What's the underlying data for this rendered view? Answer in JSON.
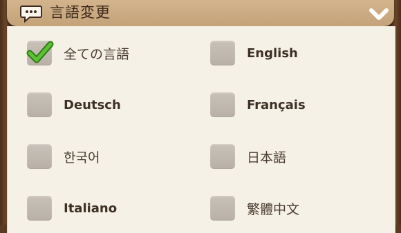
{
  "header": {
    "title": "言語変更",
    "icon": "chat-bubble-icon",
    "collapse_icon": "chevron-down-icon"
  },
  "colors": {
    "header_bg": "#c4a27a",
    "panel_bg": "#f6f1e6",
    "checkbox": "#bdb5ab",
    "check": "#4caf2a",
    "frame": "#4a2f1b"
  },
  "languages": [
    {
      "label": "全ての言語",
      "checked": true
    },
    {
      "label": "English",
      "checked": false
    },
    {
      "label": "Deutsch",
      "checked": false
    },
    {
      "label": "Français",
      "checked": false
    },
    {
      "label": "한국어",
      "checked": false
    },
    {
      "label": "日本語",
      "checked": false
    },
    {
      "label": "Italiano",
      "checked": false
    },
    {
      "label": "繁體中文",
      "checked": false
    }
  ]
}
